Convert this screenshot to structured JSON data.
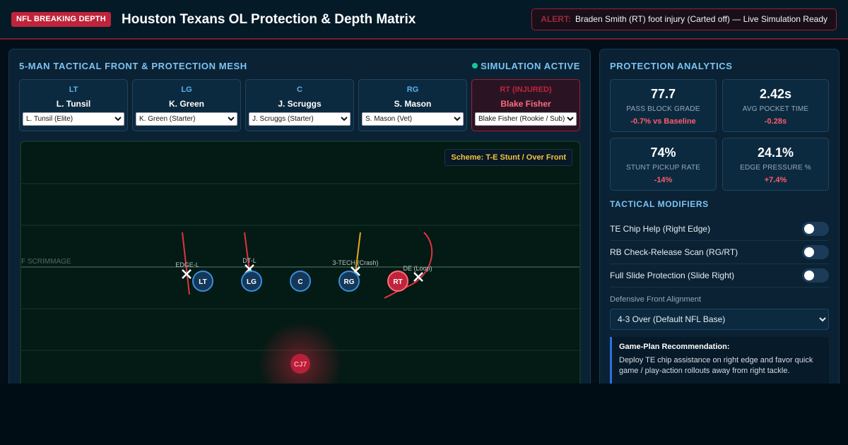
{
  "header": {
    "badge": "NFL BREAKING DEPTH",
    "title": "Houston Texans OL Protection & Depth Matrix",
    "alert_key": "ALERT:",
    "alert_text": "Braden Smith (RT) foot injury (Carted off) — Live Simulation Ready",
    "colors": {
      "badge": "#c0243a",
      "alert_border": "#9c2034"
    }
  },
  "left_panel": {
    "heading": "5-MAN TACTICAL FRONT & PROTECTION MESH",
    "status": "SIMULATION ACTIVE",
    "linemen": [
      {
        "pos": "LT",
        "name": "L. Tunsil",
        "select": "L. Tunsil (Elite)",
        "injured": false
      },
      {
        "pos": "LG",
        "name": "K. Green",
        "select": "K. Green (Starter)",
        "injured": false
      },
      {
        "pos": "C",
        "name": "J. Scruggs",
        "select": "J. Scruggs (Starter)",
        "injured": false
      },
      {
        "pos": "RG",
        "name": "S. Mason",
        "select": "S. Mason (Vet)",
        "injured": false
      },
      {
        "pos": "RT (INJURED)",
        "name": "Blake Fisher",
        "select": "Blake Fisher (Rookie / Sub)",
        "injured": true
      }
    ],
    "field": {
      "scheme": "Scheme: T-E Stunt / Over Front",
      "los_label": "F SCRIMMAGE",
      "qb_label": "CJ7",
      "defenders": [
        "EDGE-L",
        "DT-L",
        "3-TECH (Crash)",
        "DE (Loop)"
      ],
      "ol_labels": [
        "LT",
        "LG",
        "C",
        "RG",
        "RT"
      ]
    }
  },
  "right_panel": {
    "heading": "PROTECTION ANALYTICS",
    "stats": [
      {
        "value": "77.7",
        "label": "PASS BLOCK GRADE",
        "delta": "-0.7% vs Baseline"
      },
      {
        "value": "2.42s",
        "label": "AVG POCKET TIME",
        "delta": "-0.28s"
      },
      {
        "value": "74%",
        "label": "STUNT PICKUP RATE",
        "delta": "-14%"
      },
      {
        "value": "24.1%",
        "label": "EDGE PRESSURE %",
        "delta": "+7.4%"
      }
    ],
    "modifiers_heading": "TACTICAL MODIFIERS",
    "modifiers": [
      {
        "label": "TE Chip Help (Right Edge)",
        "on": false
      },
      {
        "label": "RB Check-Release Scan (RG/RT)",
        "on": false
      },
      {
        "label": "Full Slide Protection (Slide Right)",
        "on": false
      }
    ],
    "alignment_label": "Defensive Front Alignment",
    "alignment_value": "4-3 Over (Default NFL Base)",
    "recommendation_title": "Game-Plan Recommendation:",
    "recommendation_text": "Deploy TE chip assistance on right edge and favor quick game / play-action rollouts away from right tackle."
  }
}
